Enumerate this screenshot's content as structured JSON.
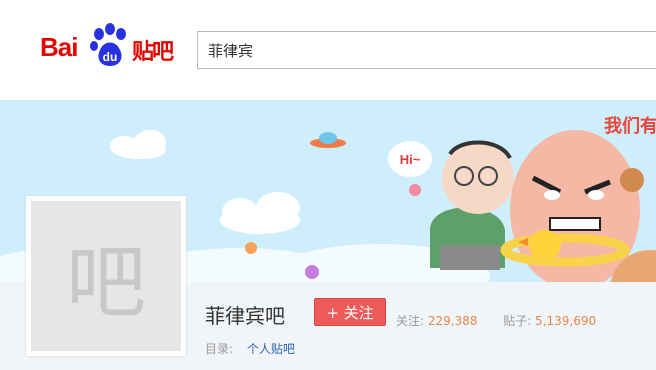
{
  "logo": {
    "bai": "Bai",
    "du": "du",
    "tieba": "贴吧"
  },
  "search": {
    "value": "菲律宾"
  },
  "banner": {
    "speech": "Hi~",
    "corner_text": "我们有"
  },
  "forum": {
    "avatar_char": "吧",
    "name": "菲律宾吧",
    "follow_label": "+ 关注",
    "followers_label": "关注:",
    "followers_value": "229,388",
    "posts_label": "贴子:",
    "posts_value": "5,139,690",
    "directory_label": "目录:",
    "directory_link": "个人贴吧"
  },
  "colors": {
    "brand_red": "#e10602",
    "brand_blue": "#2932e1",
    "sky": "#cfeefb",
    "follow": "#ee5a57",
    "stat_number": "#e6874b",
    "link": "#2d64b3"
  }
}
